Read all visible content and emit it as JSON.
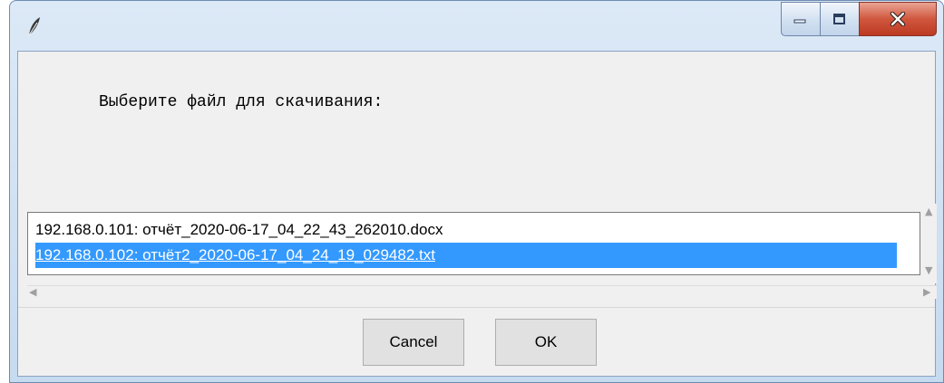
{
  "window": {
    "title": "",
    "icon": "feather-icon",
    "controls": [
      "minimize-icon",
      "maximize-icon",
      "close-icon"
    ]
  },
  "dialog": {
    "prompt": "Выберите файл для скачивания:",
    "files": [
      "192.168.0.101: отчёт_2020-06-17_04_22_43_262010.docx",
      "192.168.0.102: отчёт2_2020-06-17_04_24_19_029482.txt"
    ],
    "selected_index": 1,
    "cancel_label": "Cancel",
    "ok_label": "OK"
  },
  "colors": {
    "selection": "#3399ff",
    "close_button": "#c8442b",
    "client_bg": "#f0f0f0"
  }
}
